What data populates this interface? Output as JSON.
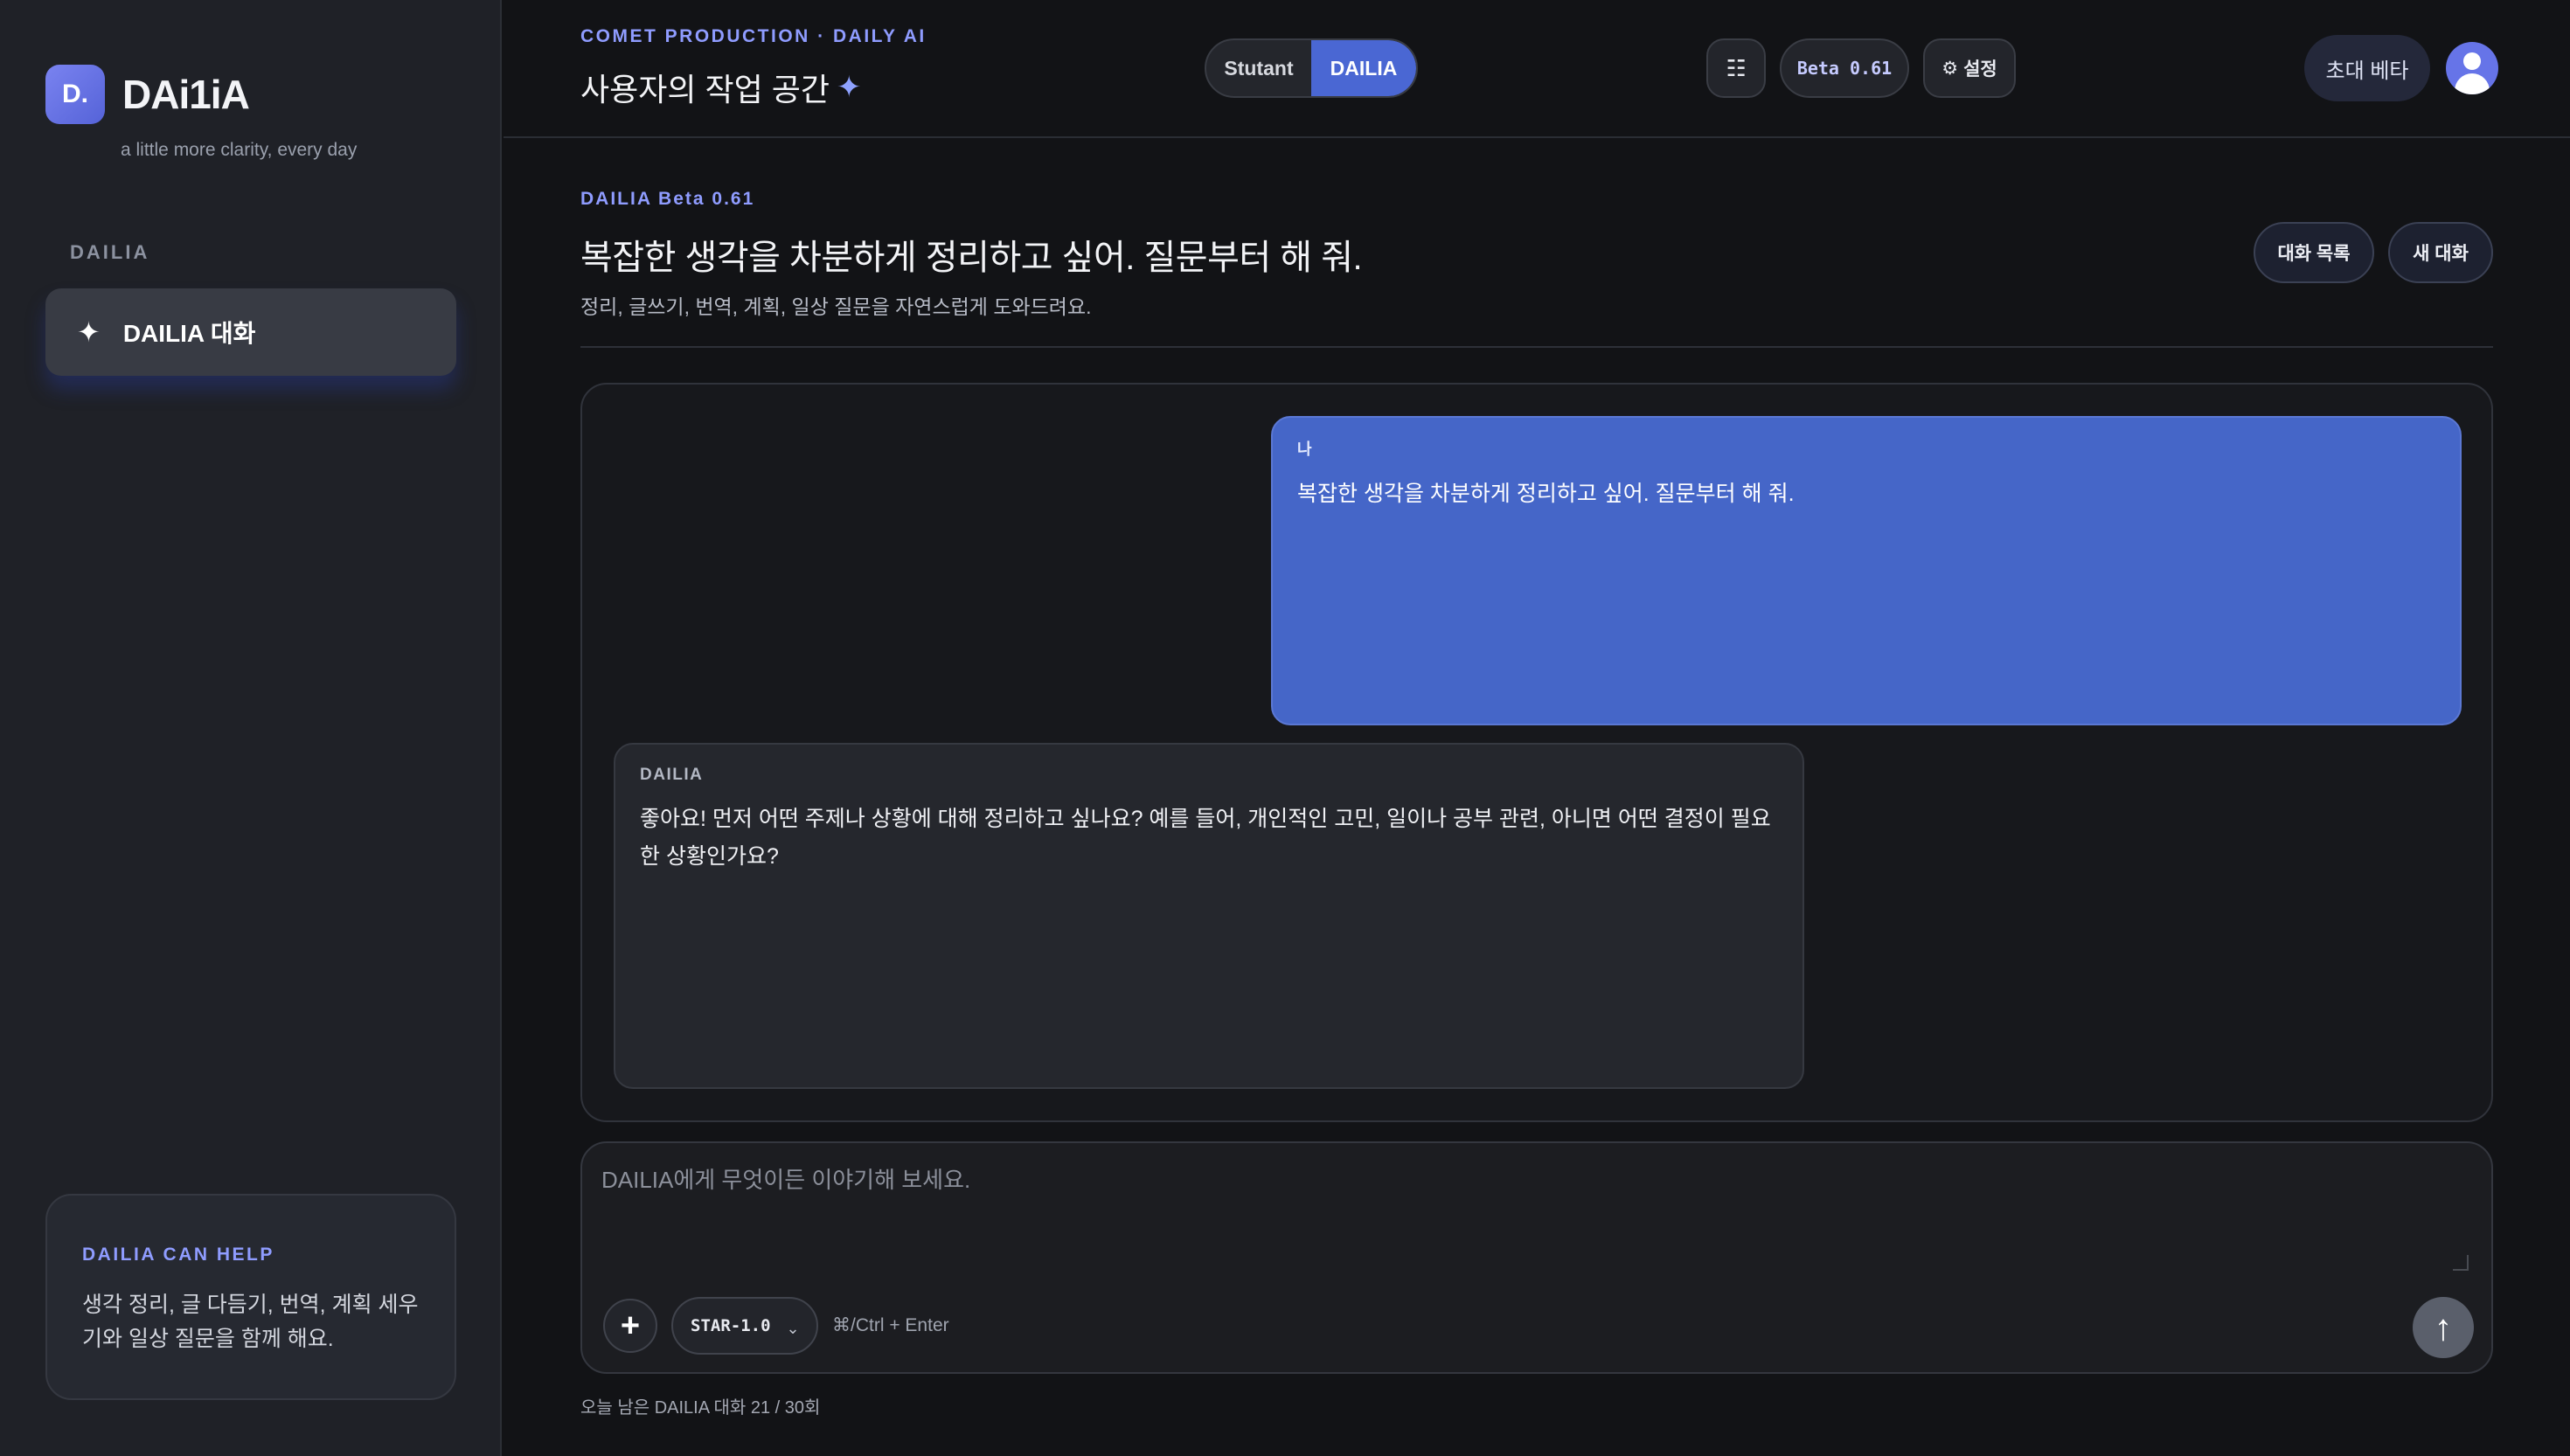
{
  "sidebar": {
    "logo_mark": "D.",
    "logo_text": "DAi1iA",
    "tagline": "a little more clarity, every day",
    "section_label": "DAILIA",
    "items": [
      {
        "icon": "sparkle-icon",
        "label": "DAILIA 대화"
      }
    ],
    "help": {
      "title": "DAILIA CAN HELP",
      "body": "생각 정리, 글 다듬기, 번역, 계획 세우기와 일상 질문을 함께 해요."
    }
  },
  "header": {
    "eyebrow": "COMET PRODUCTION · DAILY AI",
    "title": "사용자의 작업 공간",
    "title_icon": "✦",
    "modes": [
      {
        "label": "Stutant",
        "active": false
      },
      {
        "label": "DAILIA",
        "active": true
      }
    ],
    "menu_icon": "☷",
    "beta_label": "Beta 0.61",
    "settings_icon": "⚙",
    "settings_label": "설정",
    "invite_label": "초대 베타"
  },
  "chat": {
    "eyebrow": "DAILIA Beta 0.61",
    "title": "복잡한 생각을 차분하게 정리하고 싶어. 질문부터 해 줘.",
    "subtitle": "정리, 글쓰기, 번역, 계획, 일상 질문을 자연스럽게 도와드려요.",
    "list_button": "대화 목록",
    "new_button": "새 대화",
    "messages": [
      {
        "role": "user",
        "who": "나",
        "text": "복잡한 생각을 차분하게 정리하고 싶어. 질문부터 해 줘."
      },
      {
        "role": "assistant",
        "who": "DAILIA",
        "text": "좋아요! 먼저 어떤 주제나 상황에 대해 정리하고 싶나요? 예를 들어, 개인적인 고민, 일이나 공부 관련, 아니면 어떤 결정이 필요한 상황인가요?"
      }
    ]
  },
  "composer": {
    "placeholder": "DAILIA에게 무엇이든 이야기해 보세요.",
    "value": "",
    "plus_icon": "+",
    "model": "STAR-1.0",
    "model_chevron": "⌄",
    "shortcut": "⌘/Ctrl + Enter",
    "send_icon": "↑"
  },
  "quota": "오늘 남은 DAILIA 대화 21 / 30회",
  "colors": {
    "accent": "#8f9cff",
    "user_bubble": "#4566c8",
    "mode_active": "#4a67d3"
  }
}
